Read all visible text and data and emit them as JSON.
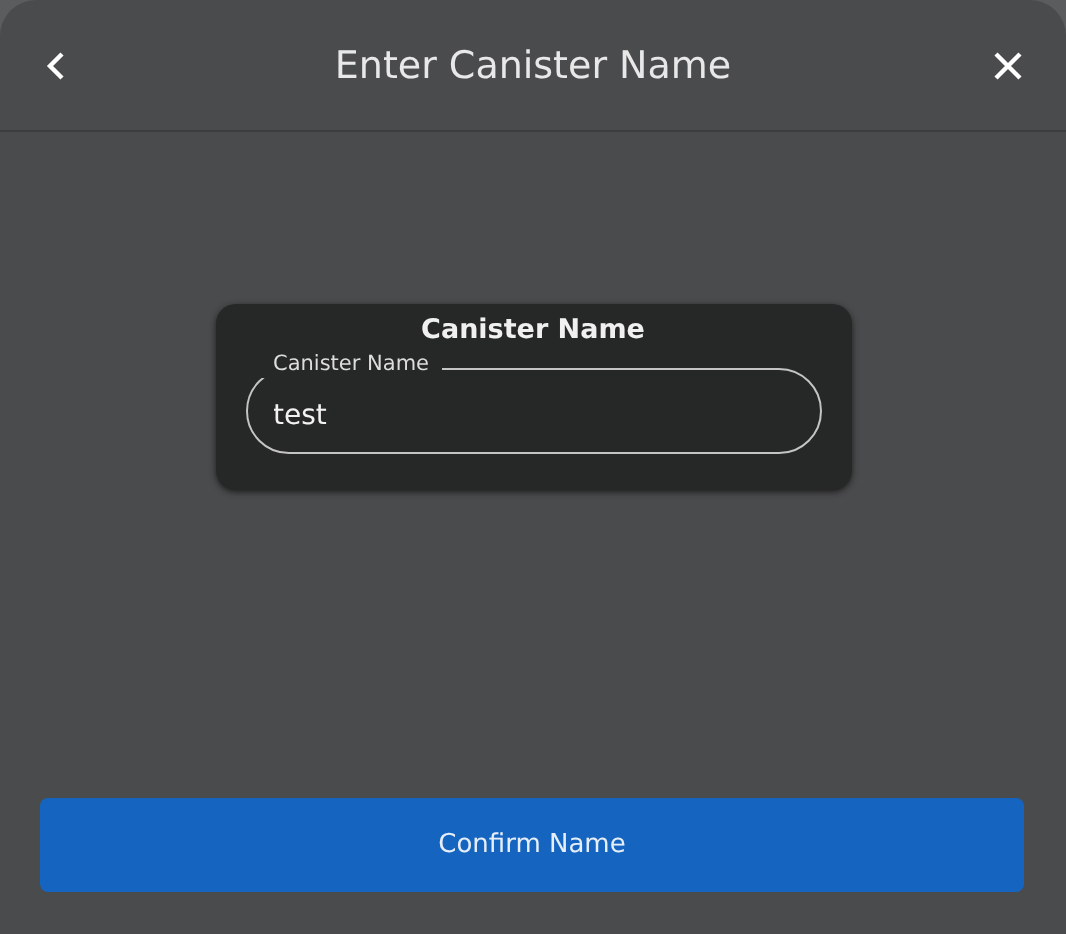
{
  "header": {
    "title": "Enter Canister Name"
  },
  "card": {
    "title": "Canister Name",
    "field": {
      "label": "Canister Name",
      "value": "test"
    }
  },
  "confirm_button": {
    "label": "Confirm Name"
  }
}
